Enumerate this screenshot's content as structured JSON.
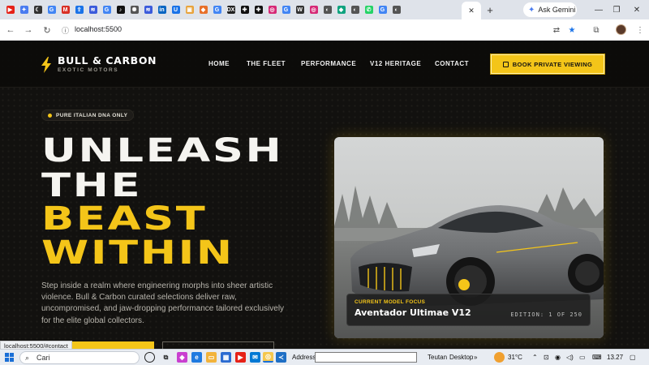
{
  "browser": {
    "tab_icons": [
      {
        "name": "youtube-favicon",
        "color": "#e62117",
        "glyph": "▶"
      },
      {
        "name": "gemini-favicon",
        "color": "#4a7cf0",
        "glyph": "✦"
      },
      {
        "name": "moon-favicon",
        "color": "#333333",
        "glyph": "☾"
      },
      {
        "name": "google-favicon",
        "color": "#4285f4",
        "glyph": "G"
      },
      {
        "name": "gmail-favicon",
        "color": "#d93025",
        "glyph": "M"
      },
      {
        "name": "bookmark-favicon",
        "color": "#1a73e8",
        "glyph": "⇪"
      },
      {
        "name": "app-favicon",
        "color": "#3b5bdb",
        "glyph": "≋"
      },
      {
        "name": "google-favicon",
        "color": "#4285f4",
        "glyph": "G"
      },
      {
        "name": "tiktok-favicon",
        "color": "#111111",
        "glyph": "♪"
      },
      {
        "name": "sun-favicon",
        "color": "#555555",
        "glyph": "✺"
      },
      {
        "name": "app-favicon",
        "color": "#3b5bdb",
        "glyph": "≋"
      },
      {
        "name": "linkedin-favicon",
        "color": "#0a66c2",
        "glyph": "in"
      },
      {
        "name": "bookmark-favicon",
        "color": "#1a73e8",
        "glyph": "U"
      },
      {
        "name": "folder-favicon",
        "color": "#e8a33c",
        "glyph": "▣"
      },
      {
        "name": "app-favicon",
        "color": "#e8702a",
        "glyph": "◆"
      },
      {
        "name": "google-favicon",
        "color": "#4285f4",
        "glyph": "G"
      },
      {
        "name": "dx-favicon",
        "color": "#222222",
        "glyph": "DX"
      },
      {
        "name": "cross-favicon",
        "color": "#111111",
        "glyph": "✚"
      },
      {
        "name": "cross-favicon",
        "color": "#111111",
        "glyph": "✚"
      },
      {
        "name": "instagram-favicon",
        "color": "#d62976",
        "glyph": "◎"
      },
      {
        "name": "google-favicon",
        "color": "#4285f4",
        "glyph": "G"
      },
      {
        "name": "wiki-favicon",
        "color": "#333333",
        "glyph": "W"
      },
      {
        "name": "instagram-favicon",
        "color": "#d62976",
        "glyph": "◎"
      },
      {
        "name": "globe-favicon",
        "color": "#555555",
        "glyph": "◐"
      },
      {
        "name": "app-favicon",
        "color": "#10a37f",
        "glyph": "◆"
      },
      {
        "name": "globe-favicon",
        "color": "#555555",
        "glyph": "◐"
      },
      {
        "name": "whatsapp-favicon",
        "color": "#25d366",
        "glyph": "✆"
      },
      {
        "name": "google-favicon",
        "color": "#4285f4",
        "glyph": "G"
      },
      {
        "name": "globe-favicon",
        "color": "#555555",
        "glyph": "◐"
      }
    ],
    "active_tab_close": "✕",
    "new_tab": "+",
    "gemini_label": "Ask Gemini",
    "url": "localhost:5500",
    "status_url": "localhost:5500/#contact"
  },
  "site": {
    "logo_title": "BULL & CARBON",
    "logo_subtitle": "EXOTIC MOTORS",
    "nav_links": [
      "HOME",
      "THE FLEET",
      "PERFORMANCE",
      "V12 HERITAGE",
      "CONTACT"
    ],
    "cta_label": "BOOK PRIVATE VIEWING",
    "badge": "PURE ITALIAN DNA ONLY",
    "headline": [
      "UNLEASH",
      "THE",
      "BEAST",
      "WITHIN"
    ],
    "description": "Step inside a realm where engineering morphs into sheer artistic violence. Bull & Carbon curated selections deliver raw, uncompromised, and jaw-dropping performance tailored exclusively for the elite global collectors.",
    "card_label": "CURRENT MODEL FOCUS",
    "card_model": "Aventador Ultimae V12",
    "card_edition": "EDITION: 1 OF 250",
    "accent_color": "#f4c519"
  },
  "taskbar": {
    "search_text": "Cari",
    "address_label": "Address",
    "tray_items": [
      "Teutan",
      "Desktop"
    ],
    "temperature": "31°C",
    "time": "13.27"
  }
}
